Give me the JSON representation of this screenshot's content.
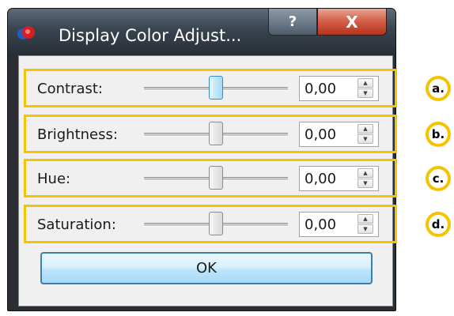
{
  "window": {
    "title": "Display Color Adjust...",
    "help_label": "?",
    "close_label": "X"
  },
  "rows": [
    {
      "label": "Contrast:",
      "value": "0,00",
      "marker": "a."
    },
    {
      "label": "Brightness:",
      "value": "0,00",
      "marker": "b."
    },
    {
      "label": "Hue:",
      "value": "0,00",
      "marker": "c."
    },
    {
      "label": "Saturation:",
      "value": "0,00",
      "marker": "d."
    }
  ],
  "spin": {
    "up": "▲",
    "down": "▼"
  },
  "ok_label": "OK",
  "colors": {
    "highlight": "#f5c400",
    "focus_thumb": "#9fdcf5",
    "close_red": "#d5634a"
  },
  "icons": {
    "app": "color-balls-icon",
    "help": "help-icon",
    "close": "close-icon"
  }
}
